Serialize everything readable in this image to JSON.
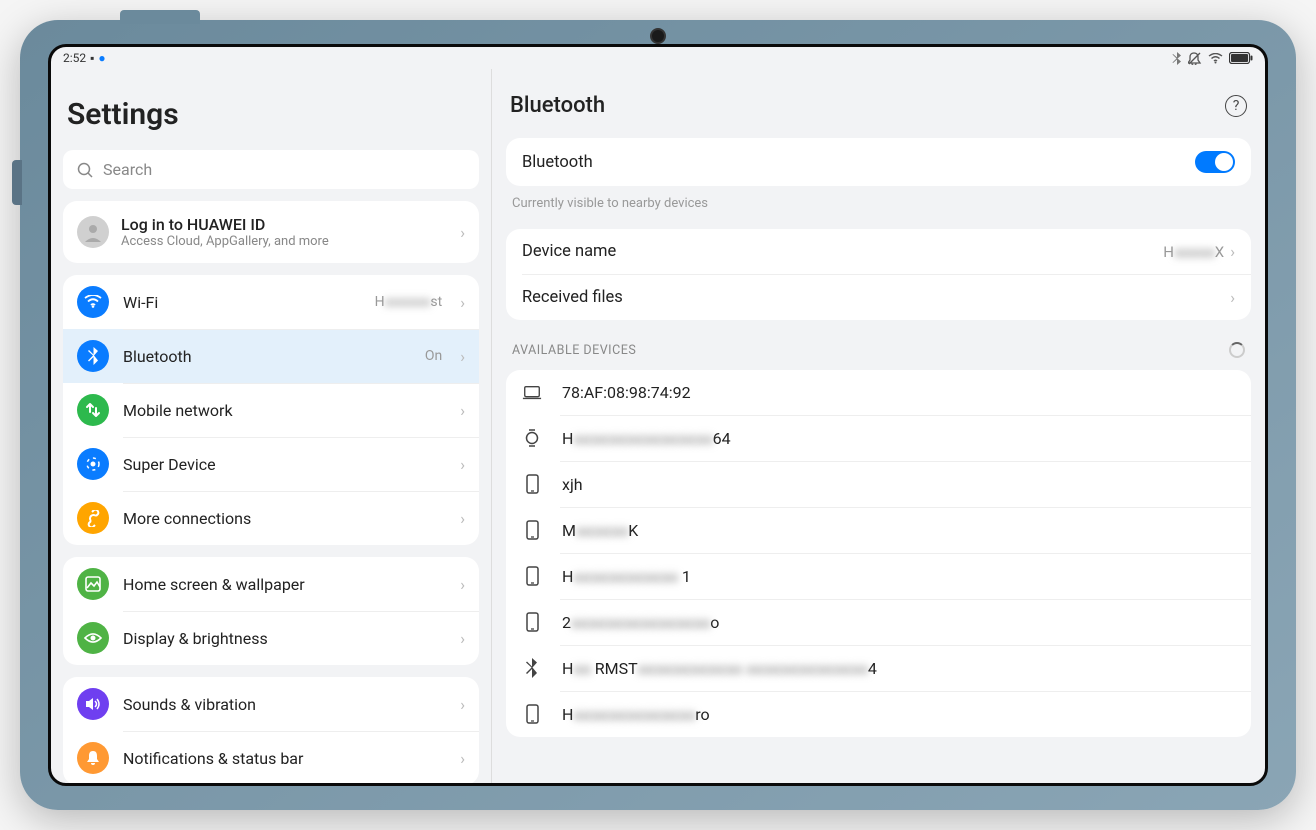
{
  "status": {
    "time": "2:52",
    "icons_right": [
      "bluetooth",
      "mute",
      "wifi",
      "battery"
    ]
  },
  "settings_title": "Settings",
  "search_placeholder": "Search",
  "account": {
    "title": "Log in to HUAWEI ID",
    "subtitle": "Access Cloud, AppGallery, and more"
  },
  "nav": {
    "wifi": {
      "label": "Wi-Fi",
      "value": "H████st"
    },
    "bluetooth": {
      "label": "Bluetooth",
      "value": "On"
    },
    "mobile": {
      "label": "Mobile network"
    },
    "super": {
      "label": "Super Device"
    },
    "more": {
      "label": "More connections"
    },
    "home": {
      "label": "Home screen & wallpaper"
    },
    "display": {
      "label": "Display & brightness"
    },
    "sounds": {
      "label": "Sounds & vibration"
    },
    "notify": {
      "label": "Notifications & status bar"
    }
  },
  "detail": {
    "title": "Bluetooth",
    "toggle_label": "Bluetooth",
    "toggle_on": true,
    "hint": "Currently visible to nearby devices",
    "device_name_label": "Device name",
    "device_name_value": "H████X",
    "received_label": "Received files",
    "available_header": "AVAILABLE DEVICES",
    "devices": [
      {
        "icon": "laptop",
        "label": "78:AF:08:98:74:92"
      },
      {
        "icon": "watch",
        "label": "H████████64"
      },
      {
        "icon": "phone",
        "label": "xjh"
      },
      {
        "icon": "phone",
        "label": "M███K"
      },
      {
        "icon": "phone",
        "label": "H██████ 1"
      },
      {
        "icon": "phone",
        "label": "2████████o"
      },
      {
        "icon": "bt",
        "label": "H█ RMST██████ ███████4"
      },
      {
        "icon": "phone",
        "label": "H███████ro"
      }
    ]
  },
  "colors": {
    "wifi": "#0a7cff",
    "bt": "#0a7cff",
    "mobile": "#2db94d",
    "super": "#0a7cff",
    "more": "#ffa500",
    "home": "#4fb345",
    "display": "#4fb345",
    "sounds": "#6f3ff0",
    "notify": "#ff9933"
  }
}
